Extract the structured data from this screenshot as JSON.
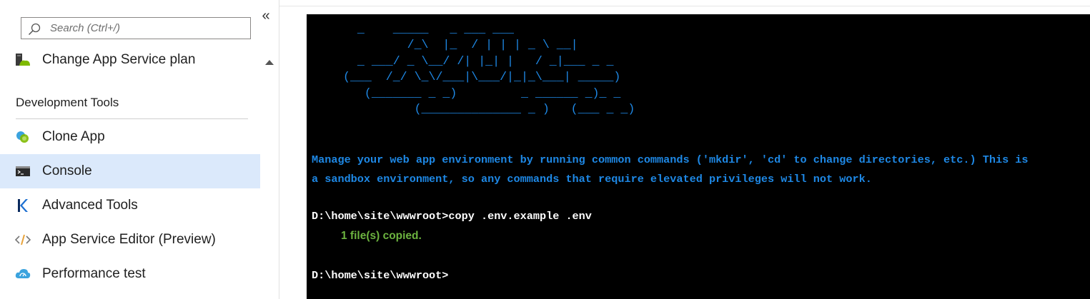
{
  "sidebar": {
    "search": {
      "placeholder": "Search (Ctrl+/)",
      "value": ""
    },
    "collapse_label": "«",
    "items_top": [
      {
        "label": "Change App Service plan",
        "icon": "app-service-plan-icon"
      }
    ],
    "section_heading": "Development Tools",
    "items": [
      {
        "label": "Clone App",
        "icon": "clone-app-icon",
        "active": false
      },
      {
        "label": "Console",
        "icon": "console-icon",
        "active": true
      },
      {
        "label": "Advanced Tools",
        "icon": "kudu-icon",
        "active": false
      },
      {
        "label": "App Service Editor (Preview)",
        "icon": "code-editor-icon",
        "active": false
      },
      {
        "label": "Performance test",
        "icon": "performance-test-icon",
        "active": false
      }
    ]
  },
  "console": {
    "ascii_banner": "  _    _____   _ ___ ___\n         /_\\  |_  / | | | _ \\ __|\n  _ ___/ _ \\__/ /| |_| |   / _|___ _ _\n(___  /_/ \\_\\/___|\\___/|_|_\\___| _____)\n   (_______ _ _)         _ ______ _)_ _\n          (______________ _ )   (___ _ _)",
    "welcome": "Manage your web app environment by running common commands ('mkdir', 'cd' to change directories, etc.) This is\na sandbox environment, so any commands that require elevated privileges will not work.",
    "lines": [
      {
        "prompt": "D:\\home\\site\\wwwroot>copy .env.example .env"
      },
      {
        "output": "1 file(s) copied."
      },
      {
        "prompt": "D:\\home\\site\\wwwroot>"
      }
    ]
  },
  "colors": {
    "active_item_bg": "#dbe9fb",
    "console_bg": "#000000",
    "console_blue": "#1e88e5",
    "console_green": "#6cb33f",
    "console_white": "#ffffff"
  }
}
